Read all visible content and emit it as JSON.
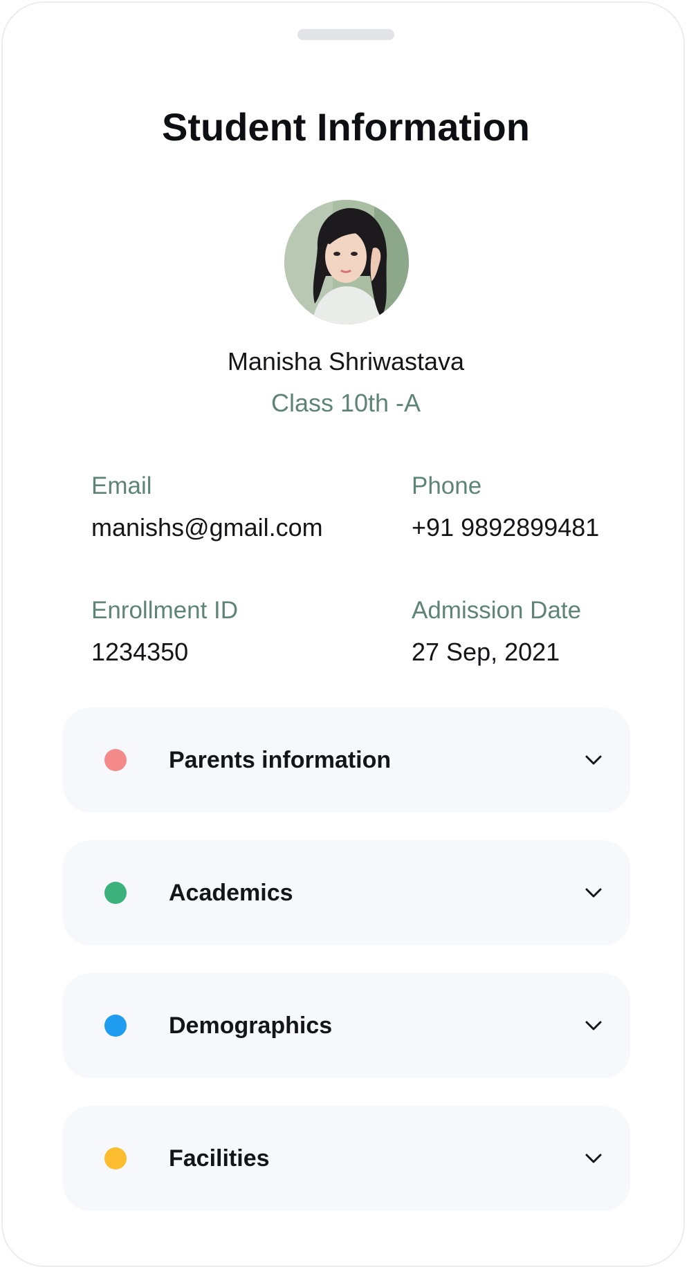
{
  "header": {
    "title": "Student Information"
  },
  "profile": {
    "name": "Manisha Shriwastava",
    "class": "Class 10th -A"
  },
  "details": [
    {
      "label": "Email",
      "value": "manishs@gmail.com"
    },
    {
      "label": "Phone",
      "value": "+91 9892899481"
    },
    {
      "label": "Enrollment ID",
      "value": "1234350"
    },
    {
      "label": "Admission Date",
      "value": "27 Sep, 2021"
    }
  ],
  "sections": [
    {
      "label": "Parents information",
      "color": "#f48a8a",
      "icon": "chevron-down-icon"
    },
    {
      "label": "Academics",
      "color": "#3bb27c",
      "icon": "chevron-down-icon"
    },
    {
      "label": "Demographics",
      "color": "#1f9bf0",
      "icon": "chevron-down-icon"
    },
    {
      "label": "Facilities",
      "color": "#fbbd2f",
      "icon": "chevron-down-icon"
    }
  ],
  "colors": {
    "accent_text": "#5e8476",
    "card_background": "#f7f8fb"
  }
}
